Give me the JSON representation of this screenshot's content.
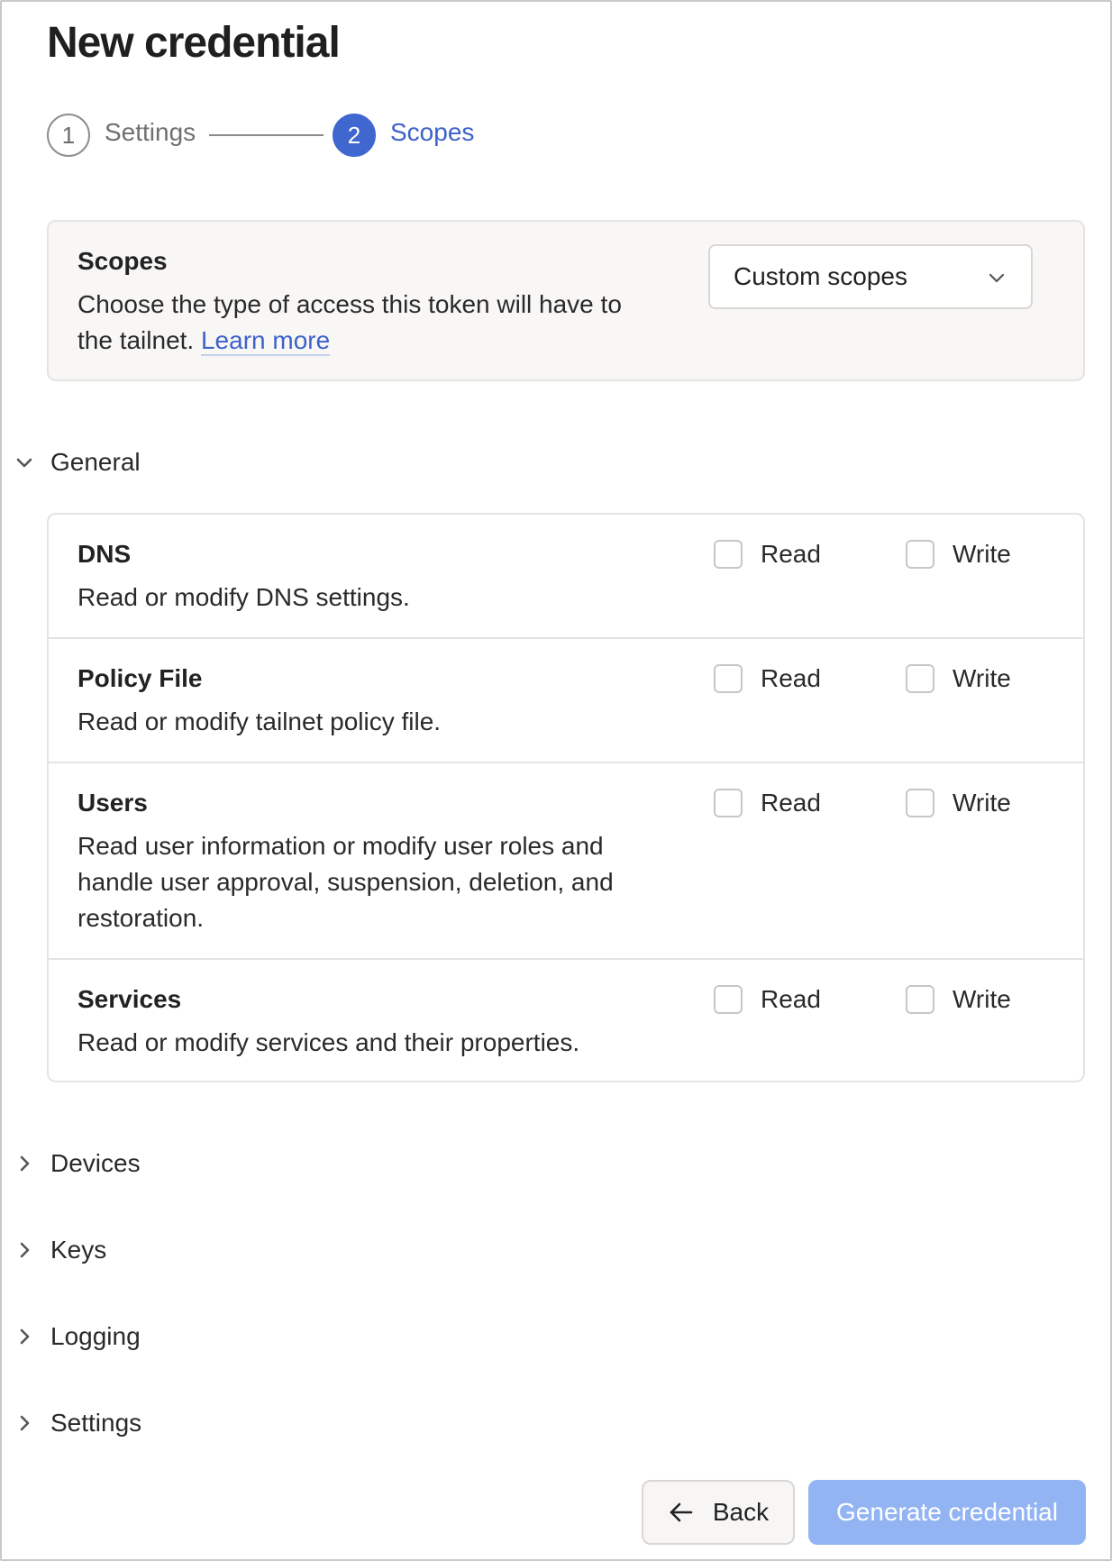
{
  "page": {
    "title": "New credential"
  },
  "stepper": {
    "steps": [
      {
        "number": "1",
        "label": "Settings",
        "state": "completed"
      },
      {
        "number": "2",
        "label": "Scopes",
        "state": "active"
      }
    ]
  },
  "scopes": {
    "title": "Scopes",
    "description": "Choose the type of access this token will have to the tailnet.",
    "link_text": "Learn more",
    "select_value": "Custom scopes"
  },
  "sections": {
    "general": {
      "label": "General",
      "expanded": true
    },
    "devices": {
      "label": "Devices",
      "expanded": false
    },
    "keys": {
      "label": "Keys",
      "expanded": false
    },
    "logging": {
      "label": "Logging",
      "expanded": false
    },
    "settings": {
      "label": "Settings",
      "expanded": false
    }
  },
  "permissions": [
    {
      "name": "DNS",
      "description": "Read or modify DNS settings.",
      "read_label": "Read",
      "write_label": "Write",
      "read": false,
      "write": false
    },
    {
      "name": "Policy File",
      "description": "Read or modify tailnet policy file.",
      "read_label": "Read",
      "write_label": "Write",
      "read": false,
      "write": false
    },
    {
      "name": "Users",
      "description": "Read user information or modify user roles and handle user approval, suspension, deletion, and restoration.",
      "read_label": "Read",
      "write_label": "Write",
      "read": false,
      "write": false
    },
    {
      "name": "Services",
      "description": "Read or modify services and their properties.",
      "read_label": "Read",
      "write_label": "Write",
      "read": false,
      "write": false
    }
  ],
  "footer": {
    "back_label": "Back",
    "generate_label": "Generate credential",
    "generate_enabled": false
  },
  "colors": {
    "accent": "#3f67cf",
    "link": "#3d62c8",
    "disabled_button": "#93b4f3"
  },
  "icons": {
    "select_chevron": "chevron-down-icon",
    "expanded_section": "chevron-down-icon",
    "collapsed_section": "chevron-right-icon",
    "back": "arrow-left-icon"
  }
}
